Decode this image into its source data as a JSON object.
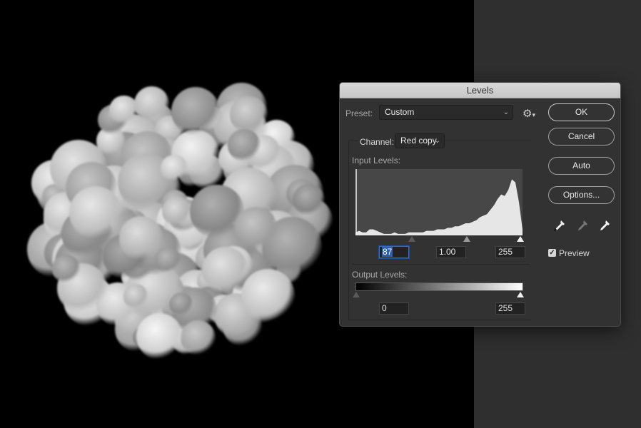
{
  "dialog": {
    "title": "Levels",
    "preset": {
      "label": "Preset:",
      "value": "Custom"
    },
    "preset_options_icon": "gear-icon",
    "channel": {
      "label": "Channel:",
      "value": "Red copy"
    },
    "input_levels": {
      "label": "Input Levels:",
      "black": "87",
      "gamma": "1.00",
      "white": "255"
    },
    "output_levels": {
      "label": "Output Levels:",
      "black": "0",
      "white": "255"
    },
    "buttons": {
      "ok": "OK",
      "cancel": "Cancel",
      "auto": "Auto",
      "options": "Options..."
    },
    "eyedroppers": [
      "black-point-eyedropper-icon",
      "gray-point-eyedropper-icon",
      "white-point-eyedropper-icon"
    ],
    "preview": {
      "label": "Preview",
      "checked": true
    }
  },
  "histogram": {
    "description": "luminance distribution, low counts through midtones rising to a peak near 240 then dropping at 255",
    "bins": [
      2,
      3,
      2,
      2,
      4,
      4,
      3,
      2,
      1,
      1,
      1,
      2,
      1,
      1,
      1,
      2,
      2,
      2,
      2,
      2,
      3,
      3,
      3,
      4,
      4,
      4,
      5,
      5,
      6,
      6,
      7,
      8,
      8,
      9,
      10,
      12,
      13,
      14,
      17,
      20,
      24,
      27,
      26,
      30,
      37,
      35,
      22,
      4
    ]
  },
  "colors": {
    "dialog_bg": "#323232",
    "titlebar": "#cfcfcf",
    "focus": "#2d6fd6",
    "pasteboard": "#2f2f2f",
    "canvas": "#000000"
  }
}
